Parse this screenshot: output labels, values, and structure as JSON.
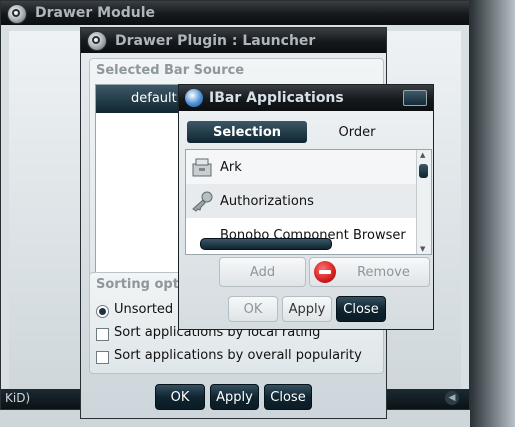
{
  "drawer_module": {
    "title": "Drawer Module",
    "bottom_text": "KiD)"
  },
  "plugin_dialog": {
    "title": "Drawer Plugin : Launcher",
    "source_group_title": "Selected Bar Source",
    "source_items": [
      "default"
    ],
    "sorting_group_title": "Sorting options",
    "sorting_options": [
      {
        "label": "Unsorted",
        "selected": true
      },
      {
        "label": "Sort applications by local rating",
        "selected": false
      },
      {
        "label": "Sort applications by overall popularity",
        "selected": false
      }
    ],
    "buttons": {
      "ok": "OK",
      "apply": "Apply",
      "close": "Close"
    }
  },
  "ibar_dialog": {
    "title": "IBar Applications",
    "tabs": [
      {
        "label": "Selection",
        "active": true
      },
      {
        "label": "Order",
        "active": false
      }
    ],
    "apps": [
      {
        "label": "Ark",
        "icon": "archive-icon"
      },
      {
        "label": "Authorizations",
        "icon": "key-icon"
      },
      {
        "label": "Bonobo Component Browser",
        "icon": "component-icon"
      }
    ],
    "add_label": "Add",
    "remove_label": "Remove",
    "buttons": {
      "ok": "OK",
      "apply": "Apply",
      "close": "Close"
    }
  },
  "colors": {
    "accent": "#0f2531",
    "remove_icon": "#d21f1f"
  }
}
